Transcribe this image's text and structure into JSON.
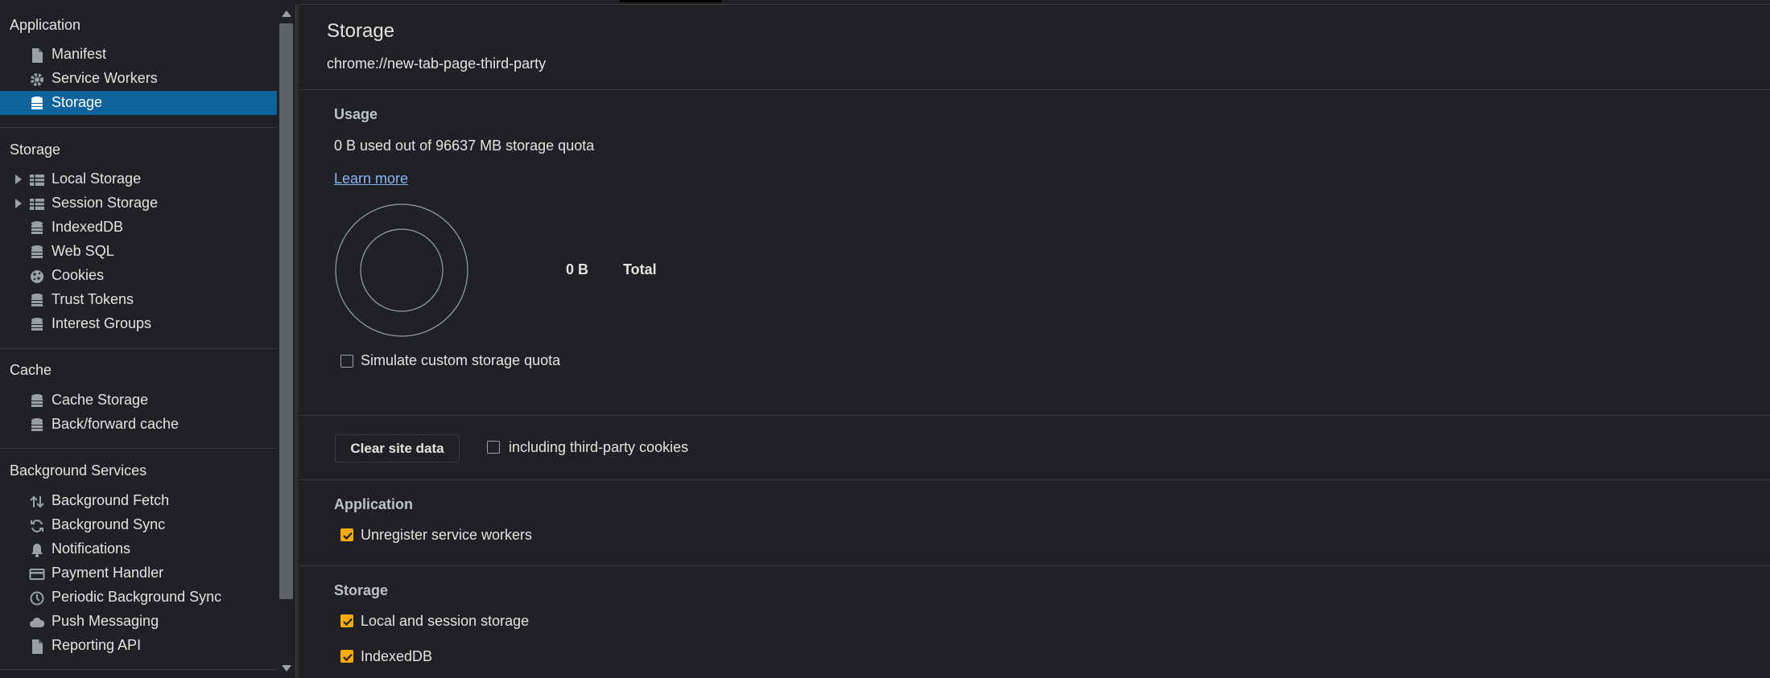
{
  "sidebar": {
    "groups": [
      {
        "title": "Application",
        "items": [
          "Manifest",
          "Service Workers",
          "Storage"
        ]
      },
      {
        "title": "Storage",
        "items": [
          "Local Storage",
          "Session Storage",
          "IndexedDB",
          "Web SQL",
          "Cookies",
          "Trust Tokens",
          "Interest Groups"
        ]
      },
      {
        "title": "Cache",
        "items": [
          "Cache Storage",
          "Back/forward cache"
        ]
      },
      {
        "title": "Background Services",
        "items": [
          "Background Fetch",
          "Background Sync",
          "Notifications",
          "Payment Handler",
          "Periodic Background Sync",
          "Push Messaging",
          "Reporting API"
        ]
      }
    ],
    "selected": "Storage"
  },
  "main": {
    "title": "Storage",
    "origin": "chrome://new-tab-page-third-party",
    "usage": {
      "title": "Usage",
      "summary": "0 B used out of 96637 MB storage quota",
      "learn_more": "Learn more",
      "total_value": "0 B",
      "total_label": "Total",
      "simulate_label": "Simulate custom storage quota"
    },
    "clear": {
      "button": "Clear site data",
      "third_party_label": "including third-party cookies"
    },
    "application_section": {
      "title": "Application",
      "unregister_label": "Unregister service workers"
    },
    "storage_section": {
      "title": "Storage",
      "local_session_label": "Local and session storage",
      "indexeddb_label": "IndexedDB"
    }
  },
  "colors": {
    "accent": "#0e639c",
    "checkbox": "#f9ab00",
    "link": "#8ab4f8",
    "background": "#202124"
  }
}
